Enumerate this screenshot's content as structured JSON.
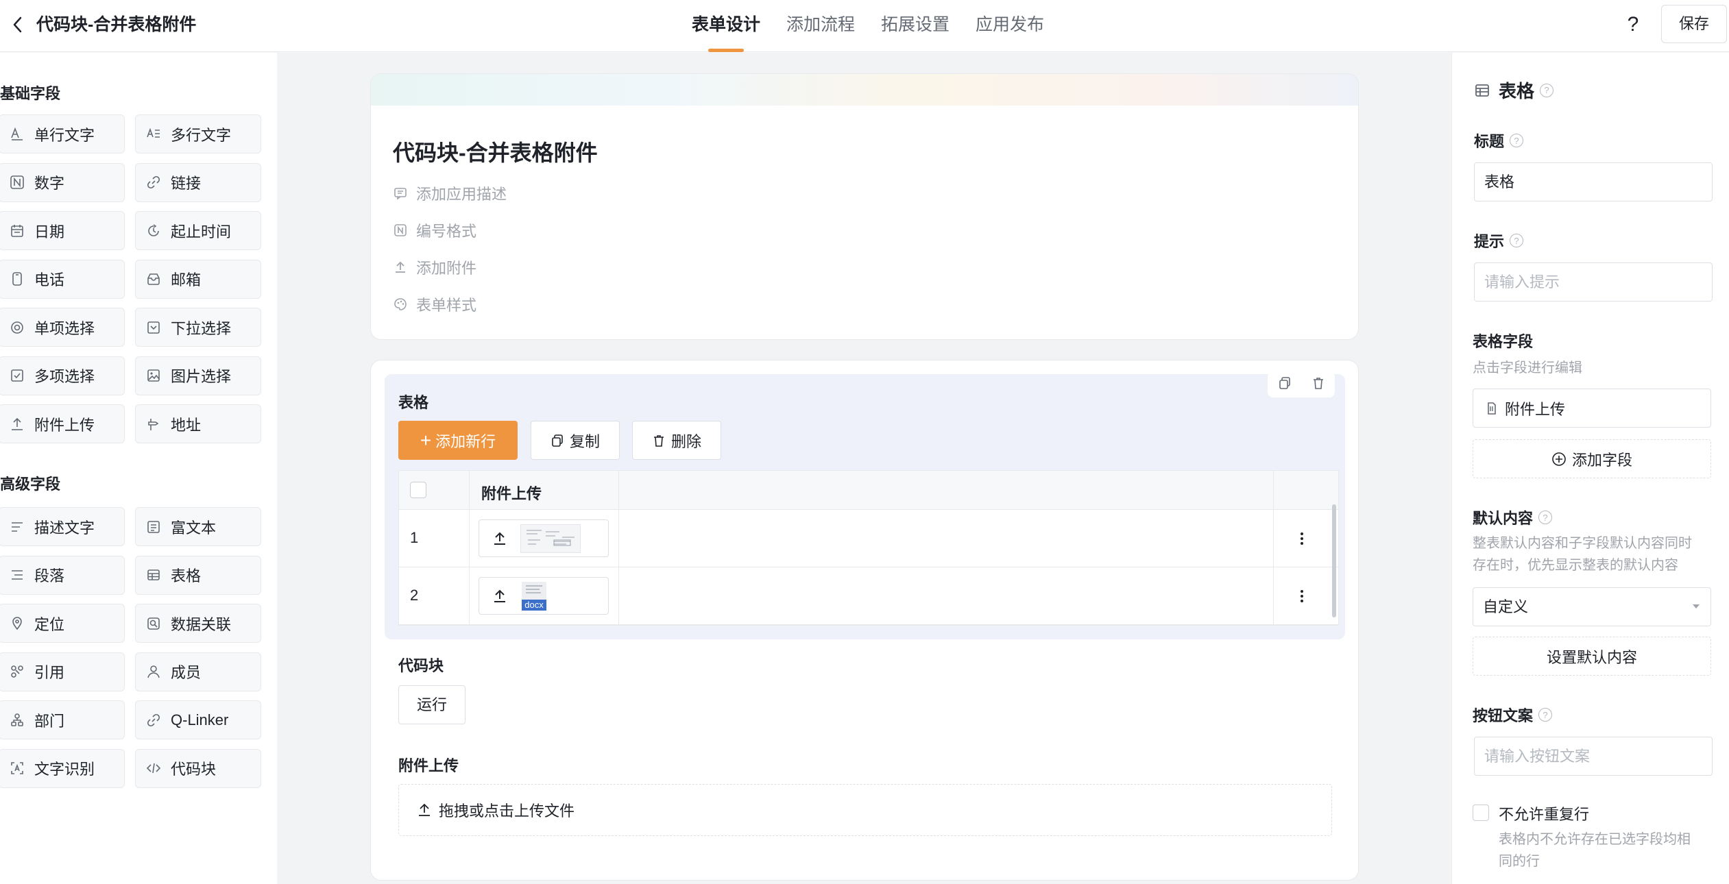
{
  "topbar": {
    "title": "代码块-合并表格附件",
    "tabs": [
      "表单设计",
      "添加流程",
      "拓展设置",
      "应用发布"
    ],
    "help": "?",
    "save_label": "保存"
  },
  "left": {
    "basic_title": "基础字段",
    "basic": [
      {
        "label": "单行文字",
        "icon": "single-line-text-icon"
      },
      {
        "label": "多行文字",
        "icon": "multi-line-text-icon"
      },
      {
        "label": "数字",
        "icon": "number-icon"
      },
      {
        "label": "链接",
        "icon": "link-icon"
      },
      {
        "label": "日期",
        "icon": "calendar-icon"
      },
      {
        "label": "起止时间",
        "icon": "time-range-icon"
      },
      {
        "label": "电话",
        "icon": "phone-icon"
      },
      {
        "label": "邮箱",
        "icon": "mailbox-icon"
      },
      {
        "label": "单项选择",
        "icon": "radio-icon"
      },
      {
        "label": "下拉选择",
        "icon": "dropdown-icon"
      },
      {
        "label": "多项选择",
        "icon": "checkbox-icon"
      },
      {
        "label": "图片选择",
        "icon": "image-icon"
      },
      {
        "label": "附件上传",
        "icon": "upload-icon"
      },
      {
        "label": "地址",
        "icon": "address-icon"
      }
    ],
    "advanced_title": "高级字段",
    "advanced": [
      {
        "label": "描述文字",
        "icon": "description-icon"
      },
      {
        "label": "富文本",
        "icon": "rich-text-icon"
      },
      {
        "label": "段落",
        "icon": "paragraph-icon"
      },
      {
        "label": "表格",
        "icon": "table-icon"
      },
      {
        "label": "定位",
        "icon": "location-icon"
      },
      {
        "label": "数据关联",
        "icon": "data-link-icon"
      },
      {
        "label": "引用",
        "icon": "reference-icon"
      },
      {
        "label": "成员",
        "icon": "member-icon"
      },
      {
        "label": "部门",
        "icon": "department-icon"
      },
      {
        "label": "Q-Linker",
        "icon": "q-linker-icon"
      },
      {
        "label": "文字识别",
        "icon": "ocr-icon"
      },
      {
        "label": "代码块",
        "icon": "code-icon"
      }
    ]
  },
  "form": {
    "title": "代码块-合并表格附件",
    "meta": [
      "添加应用描述",
      "编号格式",
      "添加附件",
      "表单样式"
    ],
    "table": {
      "label": "表格",
      "add_row": "添加新行",
      "copy": "复制",
      "delete": "删除",
      "column": "附件上传",
      "rows": [
        {
          "index": "1",
          "thumb": "image"
        },
        {
          "index": "2",
          "thumb": "docx"
        }
      ],
      "docx_badge": "docx"
    },
    "code_block": {
      "label": "代码块",
      "run": "运行"
    },
    "upload": {
      "label": "附件上传",
      "drop": "拖拽或点击上传文件"
    }
  },
  "panel": {
    "title": "表格",
    "title_label": "标题",
    "title_value": "表格",
    "hint_label": "提示",
    "hint_placeholder": "请输入提示",
    "fields_label": "表格字段",
    "fields_desc": "点击字段进行编辑",
    "field_item": "附件上传",
    "add_field": "添加字段",
    "default_label": "默认内容",
    "default_desc_1": "整表默认内容和子字段默认内容同时",
    "default_desc_2": "存在时，优先显示整表的默认内容",
    "default_select": "自定义",
    "set_default": "设置默认内容",
    "btn_text_label": "按钮文案",
    "btn_text_placeholder": "请输入按钮文案",
    "no_dup_label": "不允许重复行",
    "no_dup_desc_1": "表格内不允许存在已选字段均相",
    "no_dup_desc_2": "同的行"
  },
  "colors": {
    "accent": "#f0953f",
    "table_bg": "#eef0fa"
  }
}
